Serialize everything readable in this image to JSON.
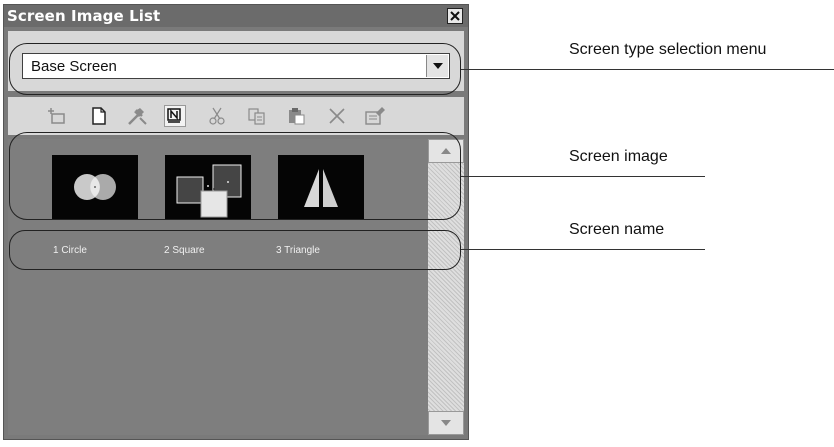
{
  "window": {
    "title": "Screen Image List",
    "close_icon": "close-icon"
  },
  "combo": {
    "value": "Base Screen"
  },
  "toolbar": {
    "icons": [
      "new-folder-icon",
      "new-page-icon",
      "tools-icon",
      "n-icon",
      "cut-icon",
      "copy-icon",
      "paste-icon",
      "delete-icon",
      "properties-icon"
    ]
  },
  "screens": [
    {
      "label": "1 Circle",
      "icon": "circle-thumbnail"
    },
    {
      "label": "2 Square",
      "icon": "square-thumbnail"
    },
    {
      "label": "3 Triangle",
      "icon": "triangle-thumbnail"
    }
  ],
  "callouts": {
    "type_menu": "Screen type selection menu",
    "image": "Screen image",
    "name": "Screen name"
  }
}
